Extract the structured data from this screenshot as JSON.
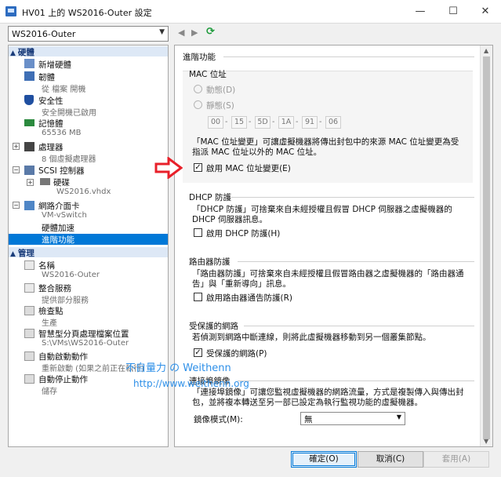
{
  "window": {
    "title": "HV01 上的 WS2016-Outer 設定"
  },
  "vm_selector": {
    "value": "WS2016-Outer"
  },
  "hardware": {
    "header": "硬體",
    "items": [
      {
        "label": "新增硬體",
        "sub": ""
      },
      {
        "label": "韌體",
        "sub": "從 檔案 開機"
      },
      {
        "label": "安全性",
        "sub": "安全開機已啟用"
      },
      {
        "label": "記憶體",
        "sub": "65536 MB"
      },
      {
        "label": "處理器",
        "sub": "8 個虛擬處理器"
      },
      {
        "label": "SCSI 控制器",
        "sub": ""
      },
      {
        "label": "硬碟",
        "sub": "WS2016.vhdx"
      },
      {
        "label": "網路介面卡",
        "sub": "VM-vSwitch"
      },
      {
        "label": "硬體加速",
        "sub": ""
      },
      {
        "label": "進階功能",
        "sub": ""
      }
    ]
  },
  "management": {
    "header": "管理",
    "items": [
      {
        "label": "名稱",
        "sub": "WS2016-Outer"
      },
      {
        "label": "整合服務",
        "sub": "提供部分服務"
      },
      {
        "label": "檢查點",
        "sub": "生產"
      },
      {
        "label": "智慧型分頁處理檔案位置",
        "sub": "S:\\VMs\\WS2016-Outer"
      },
      {
        "label": "自動啟動動作",
        "sub": "重新啟動 (如果之前正在執行)"
      },
      {
        "label": "自動停止動作",
        "sub": "儲存"
      }
    ]
  },
  "panel": {
    "title": "進階功能",
    "mac": {
      "title": "MAC 位址",
      "dynamic_label": "動態(D)",
      "static_label": "靜態(S)",
      "octets": [
        "00",
        "15",
        "5D",
        "1A",
        "91",
        "06"
      ],
      "desc": "「MAC 位址變更」可讓虛擬機器將傳出封包中的來源 MAC 位址變更為受指派 MAC 位址以外的 MAC 位址。",
      "spoof_label": "啟用 MAC 位址變更(E)",
      "spoof_checked": true
    },
    "dhcp": {
      "title": "DHCP 防護",
      "desc": "「DHCP 防護」可捨棄來自未經授權且假冒 DHCP 伺服器之虛擬機器的 DHCP 伺服器訊息。",
      "label": "啟用 DHCP 防護(H)",
      "checked": false
    },
    "router": {
      "title": "路由器防護",
      "desc": "「路由器防護」可捨棄來自未經授權且假冒路由器之虛擬機器的「路由器通告」與「重新導向」訊息。",
      "label": "啟用路由器通告防護(R)",
      "checked": false
    },
    "protected": {
      "title": "受保護的網路",
      "desc": "若偵測到網路中斷連線，則將此虛擬機器移動到另一個叢集節點。",
      "label": "受保護的網路(P)",
      "checked": true
    },
    "mirror": {
      "title": "連接埠鏡像",
      "desc": "「連接埠鏡像」可讓您監視虛擬機器的網路流量，方式是複製傳入與傳出封包，並將複本轉送至另一部已設定為執行監視功能的虛擬機器。",
      "mode_label": "鏡像模式(M):",
      "mode_value": "無"
    }
  },
  "buttons": {
    "ok": "確定(O)",
    "cancel": "取消(C)",
    "apply": "套用(A)"
  },
  "watermark": {
    "line1": "不自量力 の Weithenn",
    "line2": "http://www.weithenn.org"
  },
  "colors": {
    "selection": "#0078d7",
    "header_bg": "#dde8f6",
    "annotation_arrow": "#e8202a",
    "watermark": "#2d8fe8"
  }
}
